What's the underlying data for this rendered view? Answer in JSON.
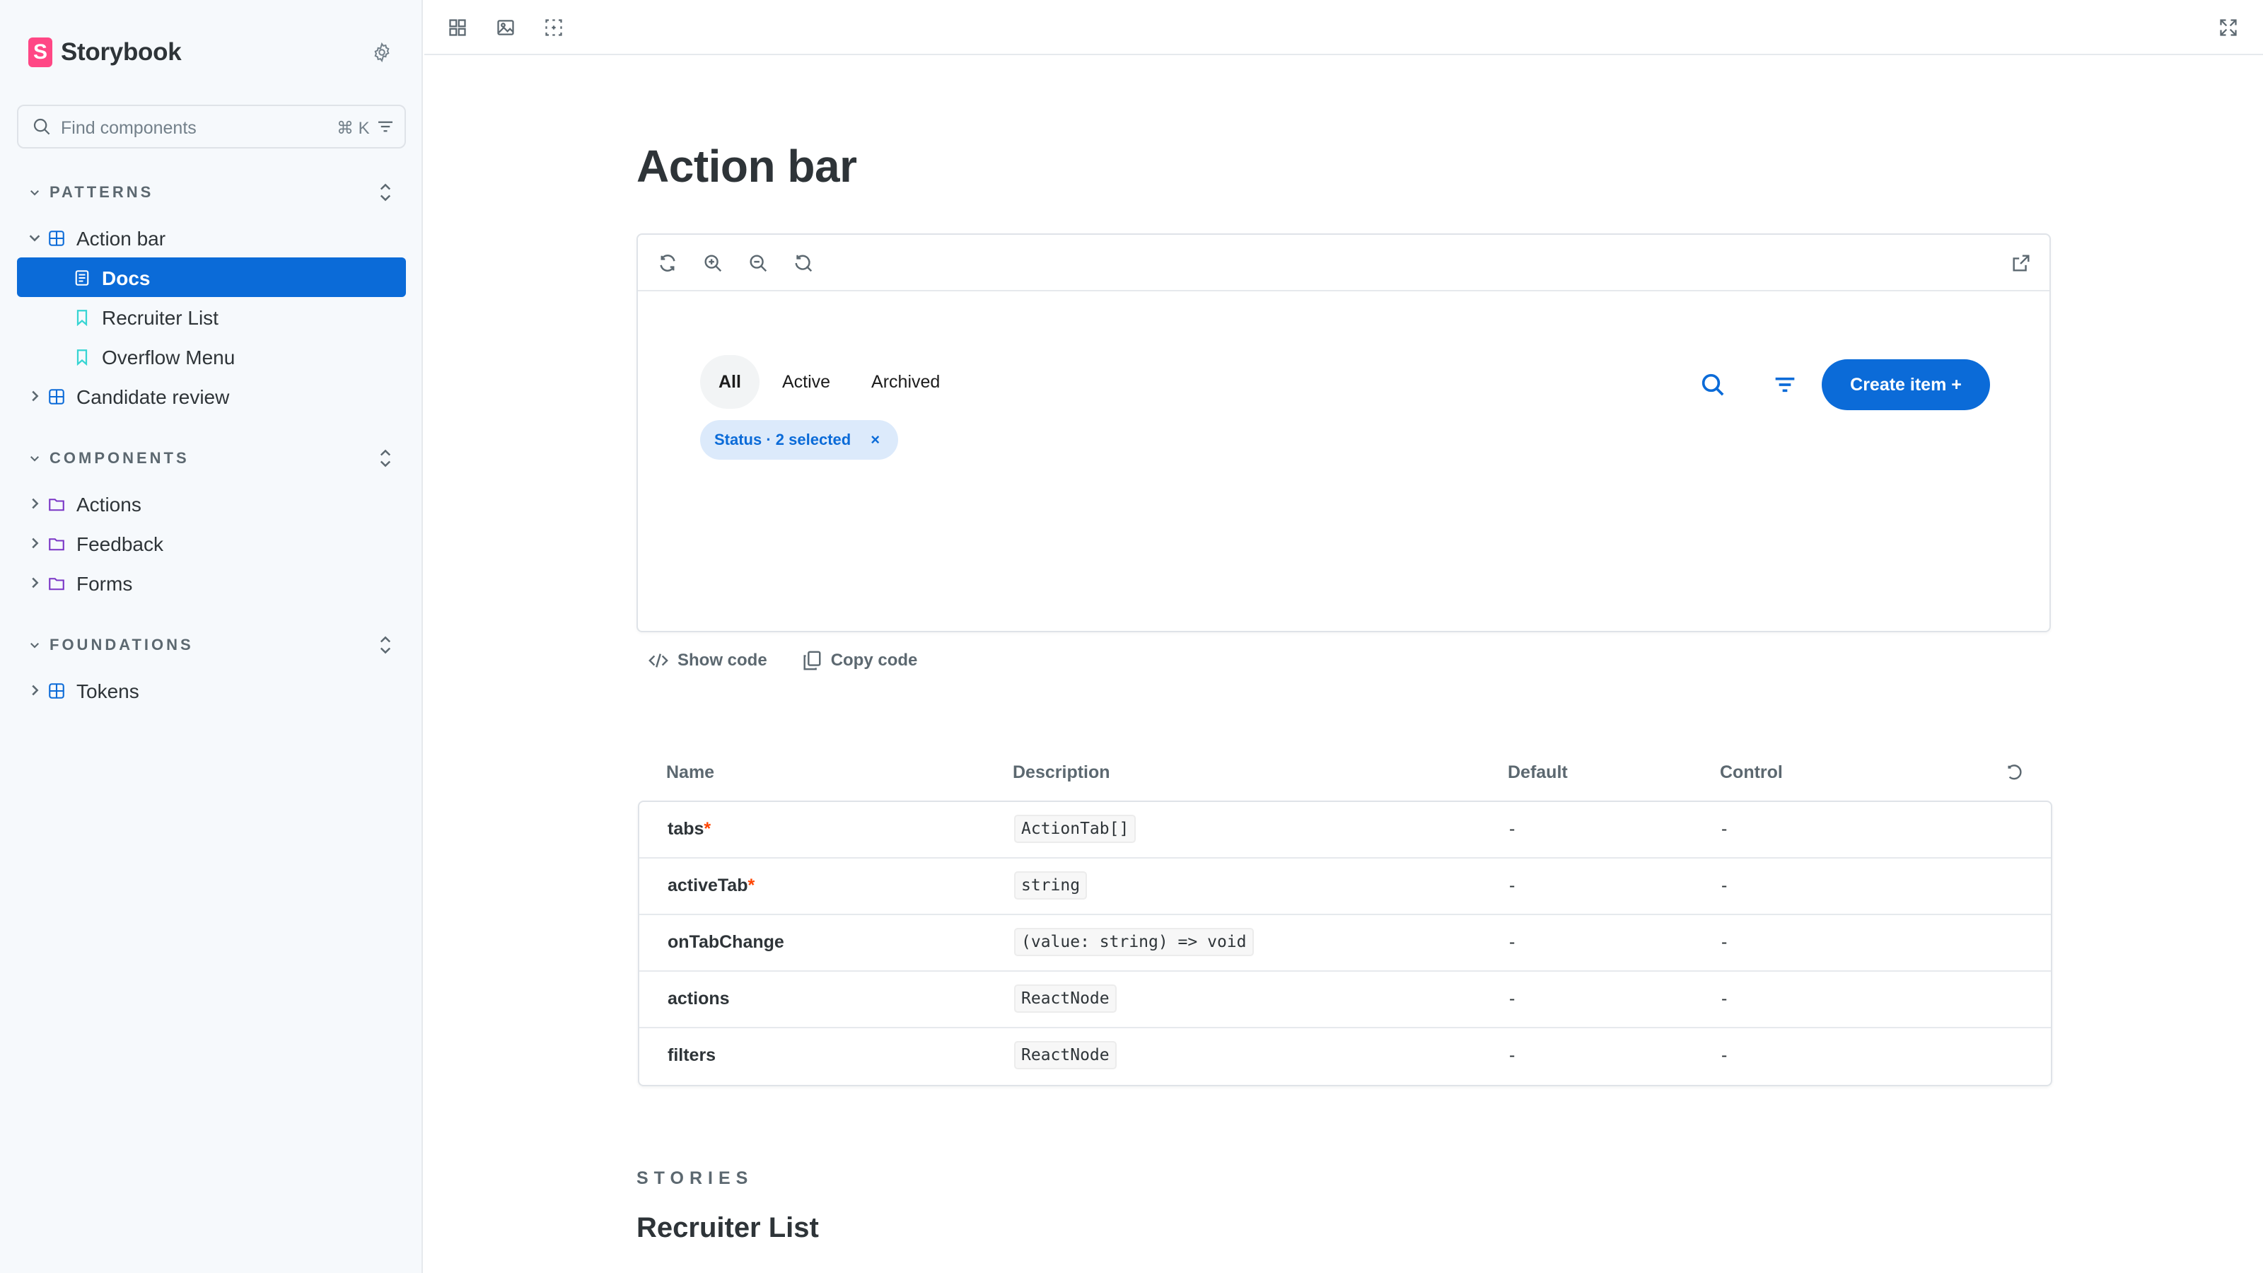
{
  "brand": {
    "name": "Storybook",
    "logo_letter": "S"
  },
  "search": {
    "placeholder": "Find components",
    "shortcut": "⌘ K"
  },
  "sidebar": {
    "sections": [
      {
        "label": "PATTERNS"
      },
      {
        "label": "COMPONENTS"
      },
      {
        "label": "FOUNDATIONS"
      }
    ],
    "items": [
      {
        "label": "Action bar"
      },
      {
        "label": "Docs"
      },
      {
        "label": "Recruiter List"
      },
      {
        "label": "Overflow Menu"
      },
      {
        "label": "Candidate review"
      },
      {
        "label": "Actions"
      },
      {
        "label": "Feedback"
      },
      {
        "label": "Forms"
      },
      {
        "label": "Tokens"
      }
    ]
  },
  "page": {
    "title": "Action bar"
  },
  "preview": {
    "tabs": [
      {
        "label": "All",
        "active": true
      },
      {
        "label": "Active",
        "active": false
      },
      {
        "label": "Archived",
        "active": false
      }
    ],
    "chip": {
      "label": "Status · 2 selected",
      "close": "×"
    },
    "create_button": "Create item +"
  },
  "code_actions": {
    "show": "Show code",
    "copy": "Copy code"
  },
  "args_table": {
    "headers": {
      "name": "Name",
      "description": "Description",
      "default": "Default",
      "control": "Control"
    },
    "rows": [
      {
        "name": "tabs",
        "required": "*",
        "type": "ActionTab[]",
        "default": "-",
        "control": "-"
      },
      {
        "name": "activeTab",
        "required": "*",
        "type": "string",
        "default": "-",
        "control": "-"
      },
      {
        "name": "onTabChange",
        "required": "",
        "type": "(value: string) => void",
        "default": "-",
        "control": "-"
      },
      {
        "name": "actions",
        "required": "",
        "type": "ReactNode",
        "default": "-",
        "control": "-"
      },
      {
        "name": "filters",
        "required": "",
        "type": "ReactNode",
        "default": "-",
        "control": "-"
      }
    ]
  },
  "stories": {
    "label": "STORIES",
    "first_title": "Recruiter List"
  },
  "colors": {
    "accent": "#0b6bd8",
    "brand": "#ff4785",
    "required": "#ff4400"
  }
}
